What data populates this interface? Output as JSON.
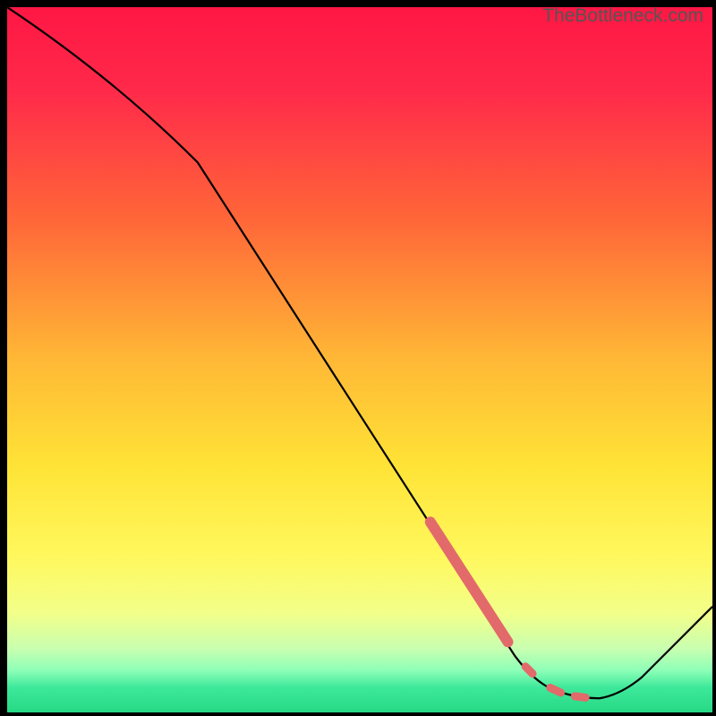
{
  "watermark": "TheBottleneck.com",
  "chart_data": {
    "type": "line",
    "title": "",
    "xlabel": "",
    "ylabel": "",
    "xlim": [
      0,
      100
    ],
    "ylim": [
      0,
      100
    ],
    "series": [
      {
        "name": "curve",
        "points": [
          {
            "x": 0,
            "y": 100
          },
          {
            "x": 27,
            "y": 78
          },
          {
            "x": 72,
            "y": 8
          },
          {
            "x": 78,
            "y": 3
          },
          {
            "x": 84,
            "y": 2
          },
          {
            "x": 90,
            "y": 5
          },
          {
            "x": 100,
            "y": 15
          }
        ]
      }
    ],
    "highlight_segments": [
      {
        "x1": 60,
        "y1": 27,
        "x2": 71,
        "y2": 10,
        "thick": true
      },
      {
        "x1": 73.5,
        "y1": 6.5,
        "x2": 74.5,
        "y2": 5.5,
        "thick": false
      },
      {
        "x1": 77,
        "y1": 3.5,
        "x2": 78.5,
        "y2": 2.8,
        "thick": false
      },
      {
        "x1": 80.5,
        "y1": 2.3,
        "x2": 82,
        "y2": 2.1,
        "thick": false
      }
    ],
    "background_gradient": {
      "stops": [
        {
          "offset": 0,
          "color": "#ff1744"
        },
        {
          "offset": 12,
          "color": "#ff2a4a"
        },
        {
          "offset": 30,
          "color": "#ff6638"
        },
        {
          "offset": 50,
          "color": "#ffb836"
        },
        {
          "offset": 65,
          "color": "#ffe336"
        },
        {
          "offset": 78,
          "color": "#fff85e"
        },
        {
          "offset": 86,
          "color": "#f2ff8a"
        },
        {
          "offset": 91,
          "color": "#c8ffb0"
        },
        {
          "offset": 94,
          "color": "#8effb8"
        },
        {
          "offset": 96.5,
          "color": "#3de89a"
        },
        {
          "offset": 100,
          "color": "#26d984"
        }
      ]
    }
  }
}
